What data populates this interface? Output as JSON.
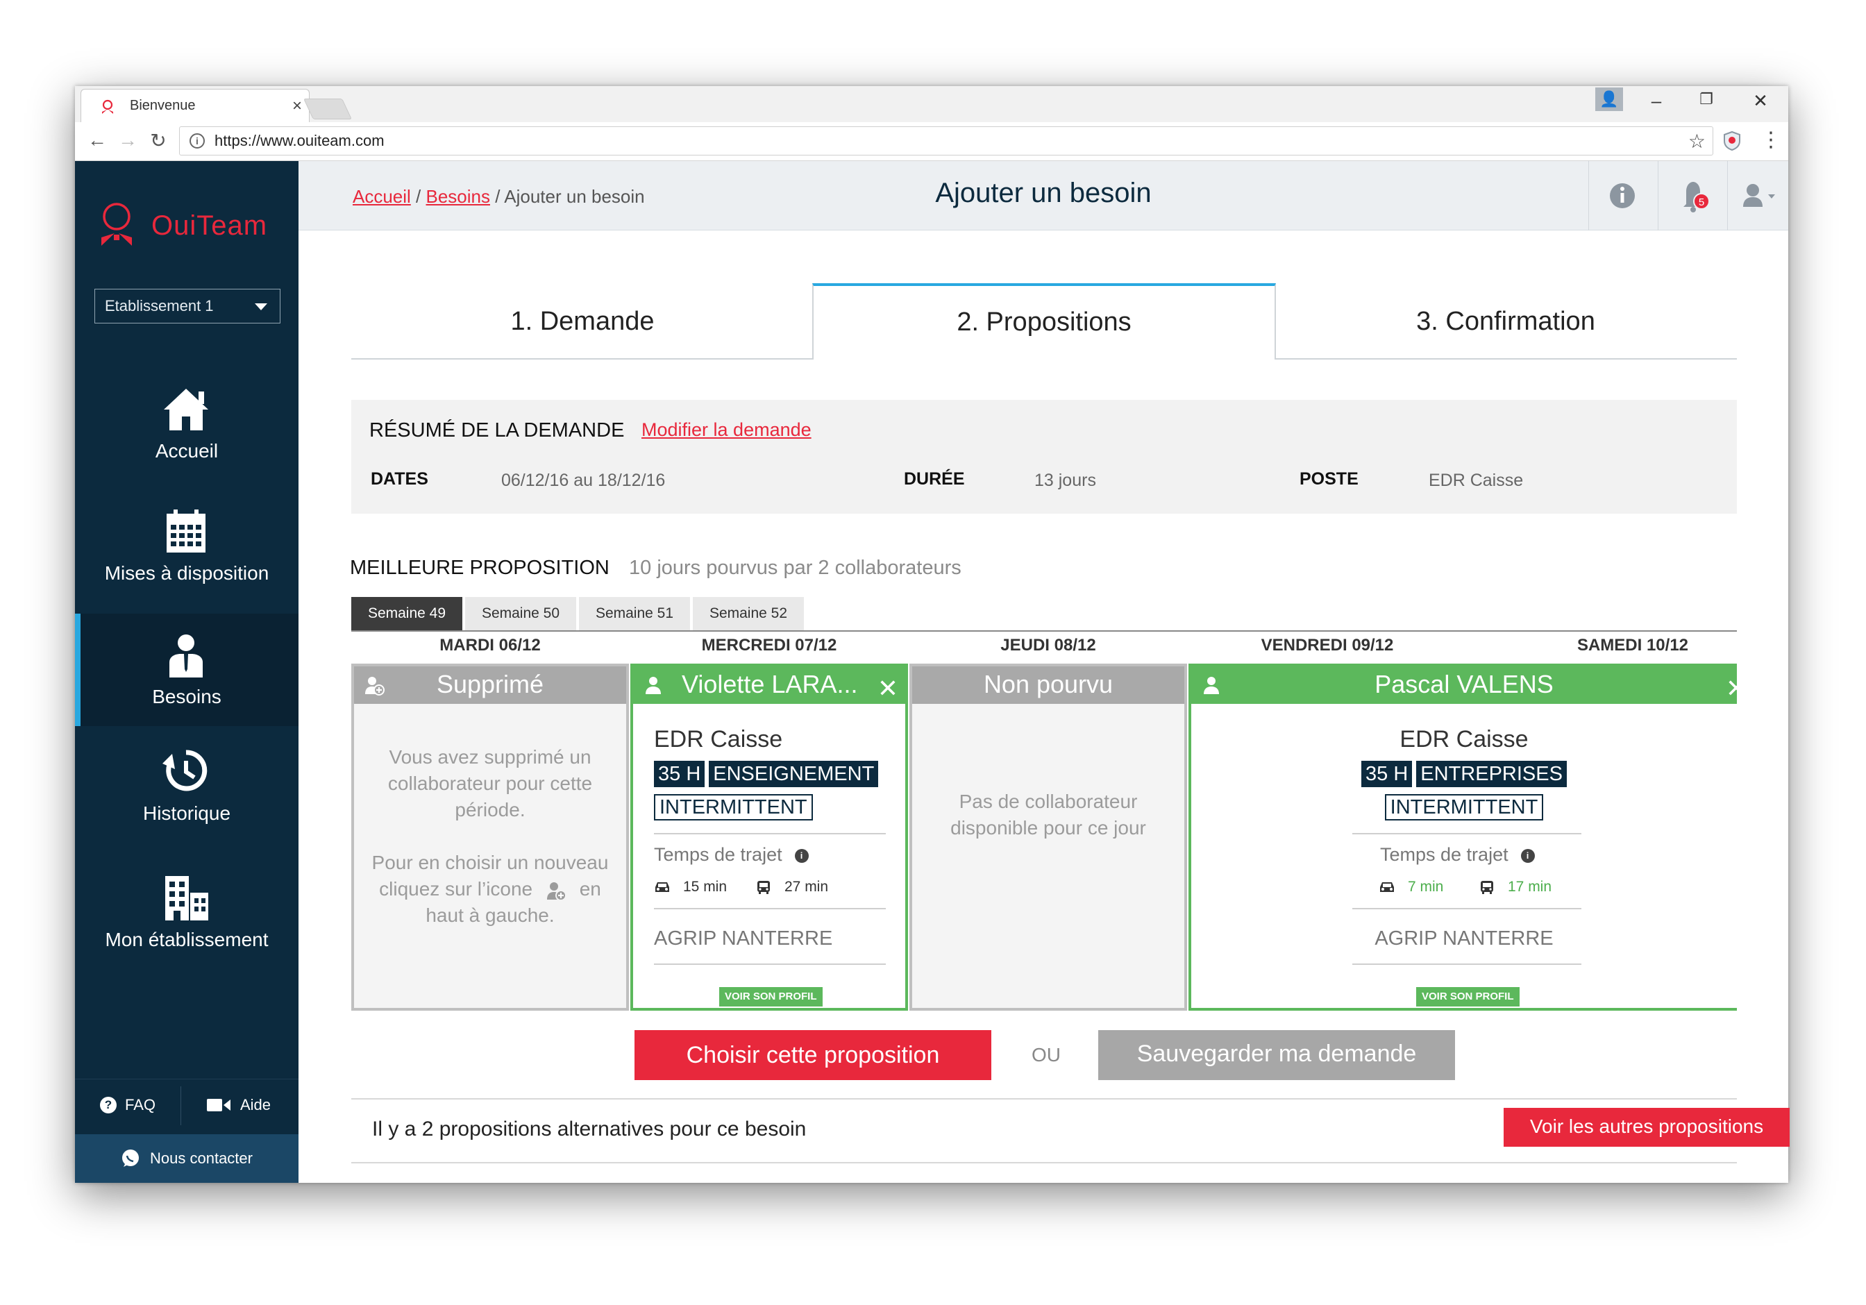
{
  "browser": {
    "tab_title": "Bienvenue",
    "tab_close": "×",
    "url": "https://www.ouiteam.com",
    "controls": {
      "minimize": "–",
      "maximize": "❐",
      "close": "✕"
    },
    "nav": {
      "back": "←",
      "forward": "→",
      "reload": "↻"
    }
  },
  "sidebar": {
    "brand": "OuiTeam",
    "establishment": "Etablissement 1",
    "items": [
      {
        "label": "Accueil",
        "icon": "home-icon",
        "active": false
      },
      {
        "label": "Mises à disposition",
        "icon": "calendar-icon",
        "active": false
      },
      {
        "label": "Besoins",
        "icon": "worker-icon",
        "active": true
      },
      {
        "label": "Historique",
        "icon": "history-icon",
        "active": false
      },
      {
        "label": "Mon établissement",
        "icon": "building-icon",
        "active": false
      }
    ],
    "faq": "FAQ",
    "aide": "Aide",
    "contact": "Nous contacter"
  },
  "header": {
    "breadcrumb": {
      "home": "Accueil",
      "sep1": " / ",
      "section": "Besoins",
      "sep2": " / ",
      "current": "Ajouter un besoin"
    },
    "title": "Ajouter un besoin",
    "notification_count": "5"
  },
  "steps": [
    {
      "label": "1. Demande",
      "active": false
    },
    {
      "label": "2. Propositions",
      "active": true
    },
    {
      "label": "3. Confirmation",
      "active": false
    }
  ],
  "summary": {
    "title": "RÉSUMÉ DE LA DEMANDE",
    "modify_link": "Modifier la demande",
    "dates_label": "DATES",
    "dates_value": "06/12/16 au 18/12/16",
    "duree_label": "DURÉE",
    "duree_value": "13 jours",
    "poste_label": "POSTE",
    "poste_value": "EDR Caisse"
  },
  "proposal": {
    "title": "MEILLEURE PROPOSITION",
    "subtitle": "10 jours pourvus par 2 collaborateurs",
    "weeks": [
      "Semaine 49",
      "Semaine 50",
      "Semaine 51",
      "Semaine 52"
    ],
    "active_week": 0,
    "days": [
      "MARDI 06/12",
      "MERCREDI 07/12",
      "JEUDI 08/12",
      "VENDREDI 09/12",
      "SAMEDI 10/12"
    ]
  },
  "cards": {
    "deleted": {
      "title": "Supprimé",
      "message1": "Vous avez supprimé un collaborateur pour cette période.",
      "message2a": "Pour en choisir un nouveau cliquez sur l’icone",
      "message2b": "en haut à gauche."
    },
    "violette": {
      "name": "Violette LARA...",
      "poste": "EDR Caisse",
      "tags": [
        "35 H",
        "ENSEIGNEMENT"
      ],
      "outline_tag": "INTERMITTENT",
      "travel_label": "Temps de trajet",
      "car_time": "15 min",
      "bus_time": "27 min",
      "location": "AGRIP NANTERRE",
      "profile_button": "VOIR SON PROFIL",
      "close": "✕"
    },
    "unfilled": {
      "title": "Non pourvu",
      "message": "Pas de collaborateur disponible pour ce jour"
    },
    "pascal": {
      "name": "Pascal VALENS",
      "poste": "EDR Caisse",
      "tags": [
        "35 H",
        "ENTREPRISES"
      ],
      "outline_tag": "INTERMITTENT",
      "travel_label": "Temps de trajet",
      "car_time": "7 min",
      "bus_time": "17 min",
      "location": "AGRIP NANTERRE",
      "profile_button": "VOIR SON PROFIL",
      "close": "✕"
    }
  },
  "actions": {
    "choose": "Choisir cette proposition",
    "or": "OU",
    "save": "Sauvegarder ma demande"
  },
  "alternatives": {
    "text": "Il y a 2 propositions alternatives pour ce besoin",
    "button": "Voir les autres propositions"
  },
  "colors": {
    "brand_red": "#e8283c",
    "sidebar_navy": "#0c2a3e",
    "accent_blue": "#29a8e0",
    "success_green": "#5cb85c",
    "muted_gray": "#a9a9a9"
  }
}
